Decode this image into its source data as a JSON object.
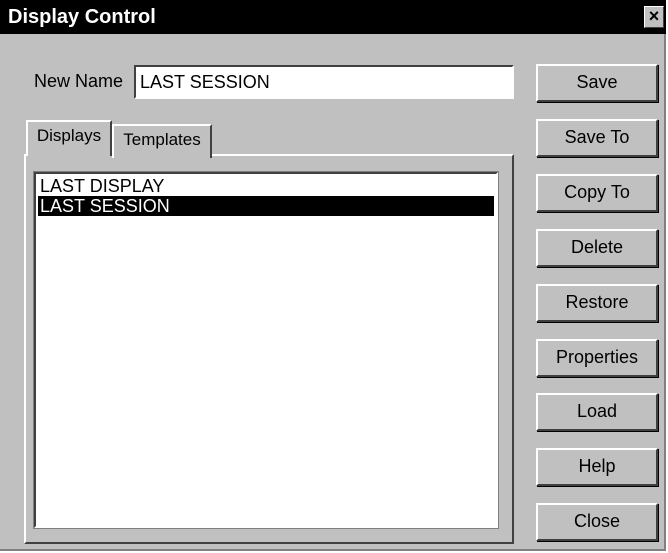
{
  "window": {
    "title": "Display Control",
    "close_glyph": "✕"
  },
  "new_name": {
    "label": "New Name",
    "value": "LAST SESSION"
  },
  "tabs": [
    {
      "label": "Displays",
      "active": true
    },
    {
      "label": "Templates",
      "active": false
    }
  ],
  "list": {
    "items": [
      "LAST DISPLAY",
      "LAST SESSION"
    ],
    "selected_index": 1
  },
  "buttons": {
    "save": "Save",
    "save_to": "Save To",
    "copy_to": "Copy To",
    "delete": "Delete",
    "restore": "Restore",
    "properties": "Properties",
    "load": "Load",
    "help": "Help",
    "close": "Close"
  },
  "colors": {
    "face": "#c0c0c0",
    "title_bar": "#000000",
    "selection": "#000000"
  }
}
